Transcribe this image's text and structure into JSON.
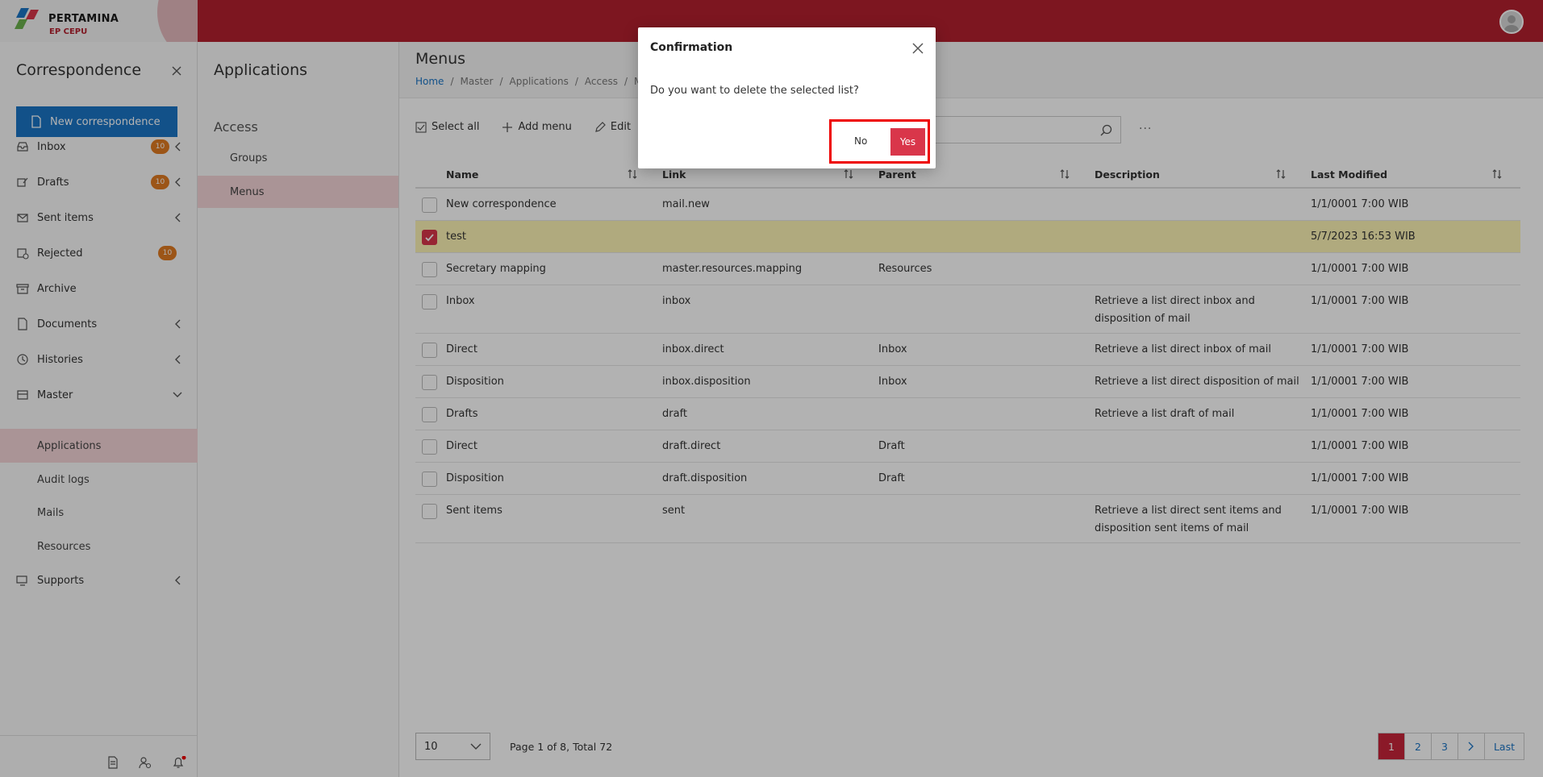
{
  "brand": {
    "name": "PERTAMINA",
    "sub": "EP CEPU"
  },
  "sidebar": {
    "title": "Correspondence",
    "new_button": "New correspondence",
    "items": [
      {
        "label": "Inbox",
        "badge": "10",
        "icon": "inbox-icon"
      },
      {
        "label": "Drafts",
        "badge": "10",
        "icon": "drafts-icon"
      },
      {
        "label": "Sent items",
        "icon": "sent-icon"
      },
      {
        "label": "Rejected",
        "badge": "10",
        "icon": "rejected-icon"
      },
      {
        "label": "Archive",
        "icon": "archive-icon"
      },
      {
        "label": "Documents",
        "icon": "documents-icon"
      },
      {
        "label": "Histories",
        "icon": "history-icon"
      },
      {
        "label": "Master",
        "icon": "master-icon"
      }
    ],
    "master_sub": [
      "Applications",
      "Audit logs",
      "Mails",
      "Resources"
    ],
    "supports": "Supports"
  },
  "col2": {
    "title": "Applications",
    "section": "Access",
    "items": [
      "Groups",
      "Menus"
    ]
  },
  "main": {
    "title": "Menus",
    "breadcrumb": [
      "Home",
      "/",
      "Master",
      "/",
      "Applications",
      "/",
      "Access",
      "/",
      "Men"
    ],
    "toolbar": {
      "select_all": "Select all",
      "add_menu": "Add menu",
      "edit": "Edit"
    },
    "more": "···"
  },
  "table": {
    "headers": [
      "Name",
      "Link",
      "Parent",
      "Description",
      "Last Modified"
    ],
    "rows": [
      {
        "name": "New correspondence",
        "link": "mail.new",
        "parent": "",
        "desc": "",
        "modified": "1/1/0001 7:00 WIB"
      },
      {
        "name": "test",
        "link": "",
        "parent": "",
        "desc": "",
        "modified": "5/7/2023 16:53 WIB"
      },
      {
        "name": "Secretary mapping",
        "link": "master.resources.mapping",
        "parent": "Resources",
        "desc": "",
        "modified": "1/1/0001 7:00 WIB"
      },
      {
        "name": "Inbox",
        "link": "inbox",
        "parent": "",
        "desc": "Retrieve a list direct inbox and disposition of mail",
        "modified": "1/1/0001 7:00 WIB"
      },
      {
        "name": "Direct",
        "link": "inbox.direct",
        "parent": "Inbox",
        "desc": "Retrieve a list direct inbox of mail",
        "modified": "1/1/0001 7:00 WIB"
      },
      {
        "name": "Disposition",
        "link": "inbox.disposition",
        "parent": "Inbox",
        "desc": "Retrieve a list direct disposition of mail",
        "modified": "1/1/0001 7:00 WIB"
      },
      {
        "name": "Drafts",
        "link": "draft",
        "parent": "",
        "desc": "Retrieve a list draft of mail",
        "modified": "1/1/0001 7:00 WIB"
      },
      {
        "name": "Direct",
        "link": "draft.direct",
        "parent": "Draft",
        "desc": "",
        "modified": "1/1/0001 7:00 WIB"
      },
      {
        "name": "Disposition",
        "link": "draft.disposition",
        "parent": "Draft",
        "desc": "",
        "modified": "1/1/0001 7:00 WIB"
      },
      {
        "name": "Sent items",
        "link": "sent",
        "parent": "",
        "desc": "Retrieve a list direct sent items and disposition sent items of mail",
        "modified": "1/1/0001 7:00 WIB"
      }
    ]
  },
  "pager": {
    "page_size": "10",
    "info": "Page 1 of 8, Total 72",
    "pages": [
      "1",
      "2",
      "3"
    ],
    "last": "Last"
  },
  "dialog": {
    "title": "Confirmation",
    "message": "Do you want to delete the selected list?",
    "no": "No",
    "yes": "Yes"
  },
  "colors": {
    "brand_red": "#b3202e",
    "primary_blue": "#1a74c5",
    "danger": "#d9364a",
    "badge": "#e07a22",
    "highlight": "#fcf4b5"
  }
}
